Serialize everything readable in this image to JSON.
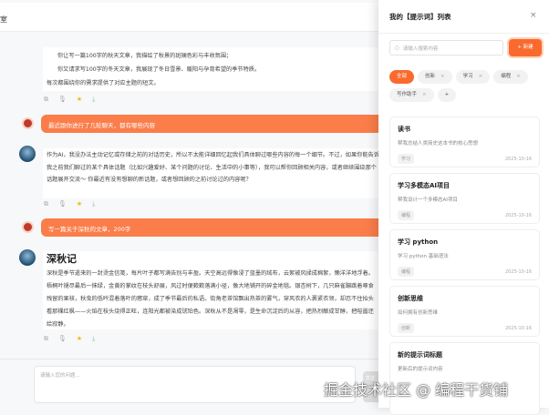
{
  "main": {
    "title": "室",
    "msg1": [
      "你让写一篇100字的秋天文章，我描绘了秋景的斑斓色彩与丰收氛围；",
      "你又请求写100字的冬天文章，我展现了冬日雪景、暖阳与孕育希望的季节特质。",
      "每次都围绕你的需求提供了对应主题的短文。"
    ],
    "user1": "最近跟你进行了几轮聊天，都有哪些内容",
    "msg2": "作为AI，我没办法主动记忆或存储之前的对话历史，所以不太能详细回忆起我们具体聊过哪些内容的每一个细节。不过，如果你能告诉我之前我们聊过的某个具体话题（比如兴趣爱好、某个问题的讨论、生活中的小事等），我可以帮你回顾相关内容，或者继续围绕那个话题展开交流～ 你最近有没有想聊的新话题，或者想回顾的之前讨论过的内容呢？",
    "user2": "写一篇关于深秋的文章，200字",
    "article_title": "深秋记",
    "article": "深秋是季节遣来的一封烫金信笺，每片叶子都写满告别与丰盈。天空高远得像浸了蓝墨的绒布，云絮被风揉成棉絮，懒洋洋地浮着。梧桐叶褪尽最后一抹绿，金黄的掌纹在枝头舒展，风过时便簌簌落满小径，像大地铺开的碎金地毯。银杏树下，几只麻雀蹦跳着啄食残留的果核，秋虫的低吟混着落叶的窸窣，成了季节最后的私语。街角老茶馆飘出热茶的雾气，穿风衣的人裹紧衣领，却忍不住抬头看那棵红枫——火焰在枝头烧得正旺，连阳光都被染成琥珀色。深秋从不是凋零，是生命沉淀后的从容，把热烈酿成甘醇，把喧嚣还给寂静。",
    "input_placeholder": "请输入您的问题...",
    "send": "发送"
  },
  "drawer": {
    "title": "我的【提示词】列表",
    "close": "×",
    "search_placeholder": "请输入搜索内容",
    "new_button": "+ 新建",
    "tags": [
      "全部",
      "创新",
      "学习",
      "编程",
      "写作助手"
    ],
    "add_tag": "+",
    "cards": [
      {
        "title": "读书",
        "desc": "帮我总结人类简史这本书的核心思想",
        "tag": "学习",
        "date": "2025-10-16"
      },
      {
        "title": "学习多模态AI项目",
        "desc": "帮我设计一个多模态AI项目",
        "tag": "编程",
        "date": "2025-10-16"
      },
      {
        "title": "学习 python",
        "desc": "学习 python 基础语法",
        "tag": "编程",
        "date": "2025-10-16"
      },
      {
        "title": "创新思维",
        "desc": "如何拥有创新思维",
        "tag": "创新",
        "date": "2025-10-16"
      },
      {
        "title": "新的提示词标题",
        "desc": "更新后的提示词内容"
      }
    ]
  },
  "watermark": "掘金技术社区 @ 编程干货铺",
  "colors": {
    "accent": "#fa6a2e",
    "user_bubble": "#fa7d4a",
    "star": "#f5b800"
  }
}
